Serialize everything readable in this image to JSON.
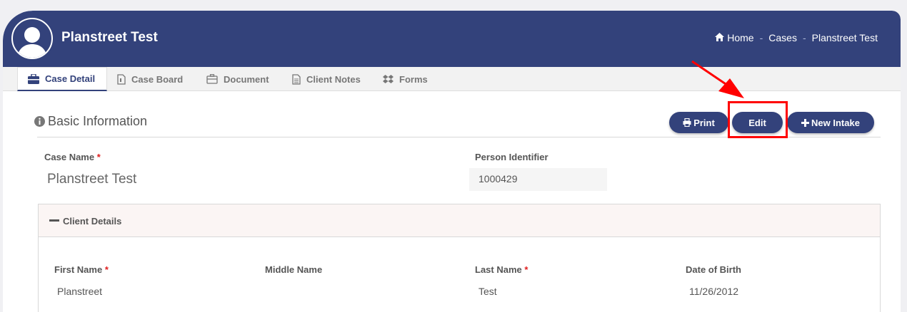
{
  "header": {
    "title": "Planstreet Test",
    "breadcrumb": {
      "home": "Home",
      "cases": "Cases",
      "current": "Planstreet Test",
      "separator": "-"
    }
  },
  "tabs": [
    {
      "label": "Case Detail",
      "icon": "briefcase-icon",
      "active": true
    },
    {
      "label": "Case Board",
      "icon": "file-icon",
      "active": false
    },
    {
      "label": "Document",
      "icon": "briefcase-outline-icon",
      "active": false
    },
    {
      "label": "Client Notes",
      "icon": "notes-icon",
      "active": false
    },
    {
      "label": "Forms",
      "icon": "forms-icon",
      "active": false
    }
  ],
  "basic_info": {
    "title": "Basic Information",
    "buttons": {
      "print": "Print",
      "edit": "Edit",
      "new_intake": "New Intake"
    },
    "case_name_label": "Case Name",
    "case_name_value": "Planstreet Test",
    "person_identifier_label": "Person Identifier",
    "person_identifier_value": "1000429",
    "required_mark": "*"
  },
  "client_details": {
    "title": "Client Details",
    "fields": [
      {
        "label": "First Name",
        "value": "Planstreet",
        "required": true
      },
      {
        "label": "Middle Name",
        "value": "",
        "required": false
      },
      {
        "label": "Last Name",
        "value": "Test",
        "required": true
      },
      {
        "label": "Date of Birth",
        "value": "11/26/2012",
        "required": false
      }
    ]
  },
  "colors": {
    "primary": "#33427b",
    "highlight": "#ff0000",
    "required": "#e02020"
  }
}
